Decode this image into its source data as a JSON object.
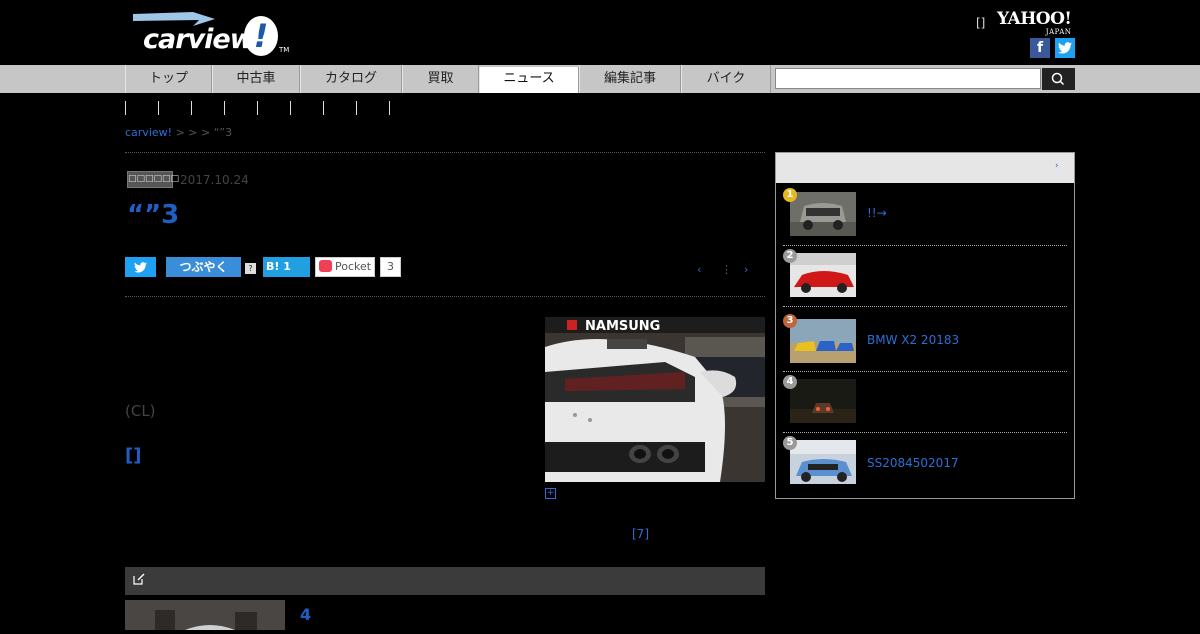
{
  "header": {
    "logo_text": "carview",
    "logo_mark": "!",
    "logo_tm": "TM",
    "top_link": "[]",
    "yahoo_text": "YAHOO!",
    "yahoo_sub": "JAPAN",
    "facebook_glyph": "f",
    "twitter_glyph": "🐦"
  },
  "nav": {
    "items": [
      {
        "label": "トップ",
        "active": false
      },
      {
        "label": "中古車",
        "active": false
      },
      {
        "label": "カタログ",
        "active": false
      },
      {
        "label": "買取",
        "active": false
      },
      {
        "label": "ニュース",
        "active": true
      },
      {
        "label": "編集記事",
        "active": false
      },
      {
        "label": "バイク",
        "active": false
      }
    ],
    "search_placeholder": ""
  },
  "breadcrumb": {
    "home": "carview!",
    "trail": "> > > “”3"
  },
  "article": {
    "category": "□□□□□□",
    "date": "2017.10.24",
    "title": "“”3",
    "lead": "(CL)",
    "bracket_link": "[]",
    "more_link": "[7]",
    "zoom_icon_glyph": "+"
  },
  "share": {
    "twitter_glyph": "🐦",
    "tsubuyaku": "つぶやく",
    "help": "?",
    "hatena": "B! 1",
    "pocket": "Pocket",
    "pocket_count": "3",
    "pager": {
      "prev": "‹",
      "sep": "⋮",
      "next": "›"
    }
  },
  "related": {
    "title": "4"
  },
  "ranking": {
    "more": "›",
    "items": [
      {
        "rank": "1",
        "title": "!!→",
        "badge_color": "#e8b820"
      },
      {
        "rank": "2",
        "title": "",
        "badge_color": "#9a9a9a"
      },
      {
        "rank": "3",
        "title": "BMW X2 20183",
        "badge_color": "#c0643a"
      },
      {
        "rank": "4",
        "title": "",
        "badge_color": "#9a9a9a"
      },
      {
        "rank": "5",
        "title": "SS2084502017",
        "badge_color": "#9a9a9a"
      }
    ]
  },
  "colors": {
    "background": "#000000",
    "link": "#2b6fd6",
    "nav_bg": "#c6c6c6"
  }
}
